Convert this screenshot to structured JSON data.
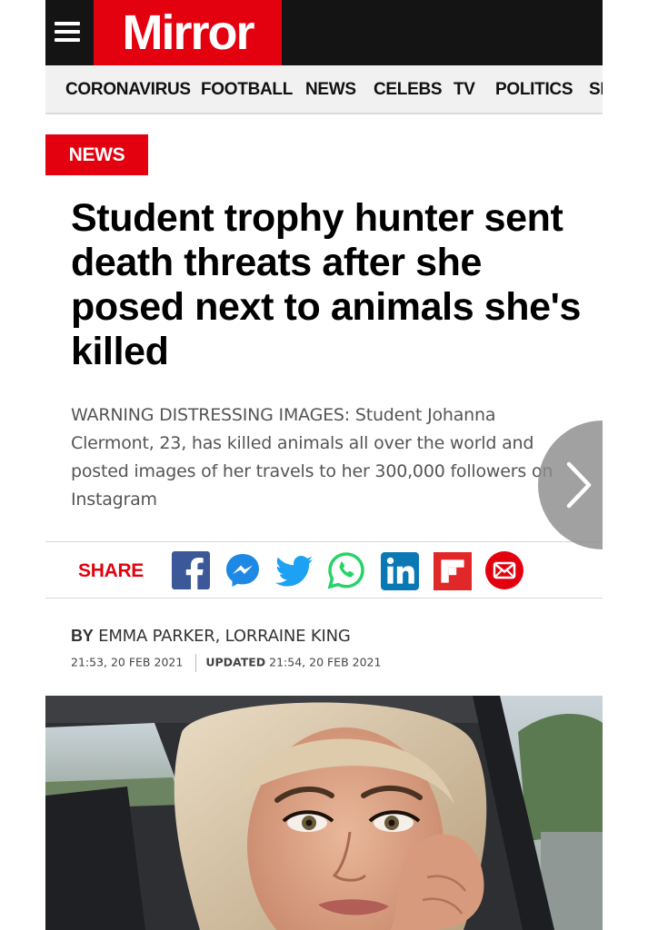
{
  "header": {
    "logo_text": "Mirror",
    "menu_icon": "hamburger-menu-icon",
    "brand_color": "#e3010f"
  },
  "nav": {
    "items": [
      "CORONAVIRUS",
      "FOOTBALL",
      "NEWS",
      "CELEBS",
      "TV",
      "POLITICS",
      "SP"
    ]
  },
  "article": {
    "category": "NEWS",
    "headline": "Student trophy hunter sent death threats after she posed next to animals she's killed",
    "standfirst": "WARNING DISTRESSING IMAGES: Student Johanna Clermont, 23, has killed animals all over the world and posted images of her travels to her 300,000 followers on Instagram",
    "share": {
      "label": "SHARE",
      "icons": [
        "facebook-icon",
        "messenger-icon",
        "twitter-icon",
        "whatsapp-icon",
        "linkedin-icon",
        "flipboard-icon",
        "email-icon"
      ]
    },
    "byline": {
      "by": "BY",
      "authors": "EMMA PARKER, LORRAINE KING",
      "published": "21:53, 20 FEB 2021",
      "updated_label": "UPDATED",
      "updated": "21:54, 20 FEB 2021"
    },
    "hero_image": "portrait-photo-of-woman-in-car"
  },
  "next_arrow_icon": "chevron-right-icon"
}
